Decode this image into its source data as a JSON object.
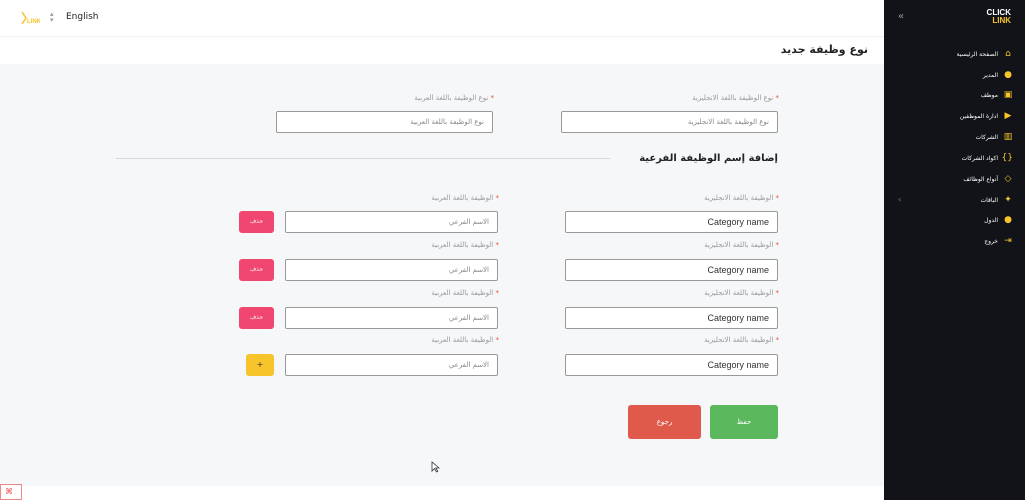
{
  "header": {
    "language": "English"
  },
  "page": {
    "title": "نوع وظيفة جديد"
  },
  "form": {
    "type_en_label": "نوع الوظيفة باللغة الانجليزية",
    "type_en_placeholder": "نوع الوظيفة باللغة الانجليزية",
    "type_ar_label": "نوع الوظيفة باللغة العربية",
    "type_ar_placeholder": "نوع الوظيفة باللغة العربية",
    "required_mark": "*",
    "subsection_title": "إضافة إسم الوظيفة الفرعية",
    "sub_rows": [
      {
        "en_label": "الوظيفة باللغة الانجليزية",
        "en_value": "Category name",
        "ar_label": "الوظيفة باللغة العربية",
        "ar_placeholder": "الاسم الفرعي",
        "action": "حذف"
      },
      {
        "en_label": "الوظيفة باللغة الانجليزية",
        "en_value": "Category name",
        "ar_label": "الوظيفة باللغة العربية",
        "ar_placeholder": "الاسم الفرعي",
        "action": "حذف"
      },
      {
        "en_label": "الوظيفة باللغة الانجليزية",
        "en_value": "Category name",
        "ar_label": "الوظيفة باللغة العربية",
        "ar_placeholder": "الاسم الفرعي",
        "action": "حذف"
      },
      {
        "en_label": "الوظيفة باللغة الانجليزية",
        "en_value": "Category name",
        "ar_label": "الوظيفة باللغة العربية",
        "ar_placeholder": "الاسم الفرعي",
        "action": "+"
      }
    ],
    "save_label": "حفظ",
    "back_label": "رجوع"
  },
  "sidebar": {
    "brand_top": "CLICK",
    "brand_bottom": "LINK",
    "items": [
      {
        "label": "الصفحة الرئيسية",
        "icon": "home-icon"
      },
      {
        "label": "المدير",
        "icon": "users-icon"
      },
      {
        "label": "موظف",
        "icon": "user-badge-icon"
      },
      {
        "label": "ادارة الموظفين",
        "icon": "video-icon"
      },
      {
        "label": "الشركات",
        "icon": "building-icon"
      },
      {
        "label": "اكواد الشركات",
        "icon": "code-icon"
      },
      {
        "label": "أنواع الوظائف",
        "icon": "tag-icon"
      },
      {
        "label": "الباقات",
        "icon": "package-icon"
      },
      {
        "label": "الدول",
        "icon": "group-icon"
      },
      {
        "label": "خروج",
        "icon": "logout-icon"
      }
    ],
    "colors": {
      "background": "#111318",
      "accent": "#f7c52b"
    }
  },
  "colors": {
    "delete": "#ef476f",
    "add": "#f7c52b",
    "save": "#5cb85c",
    "back": "#e05a4c"
  }
}
